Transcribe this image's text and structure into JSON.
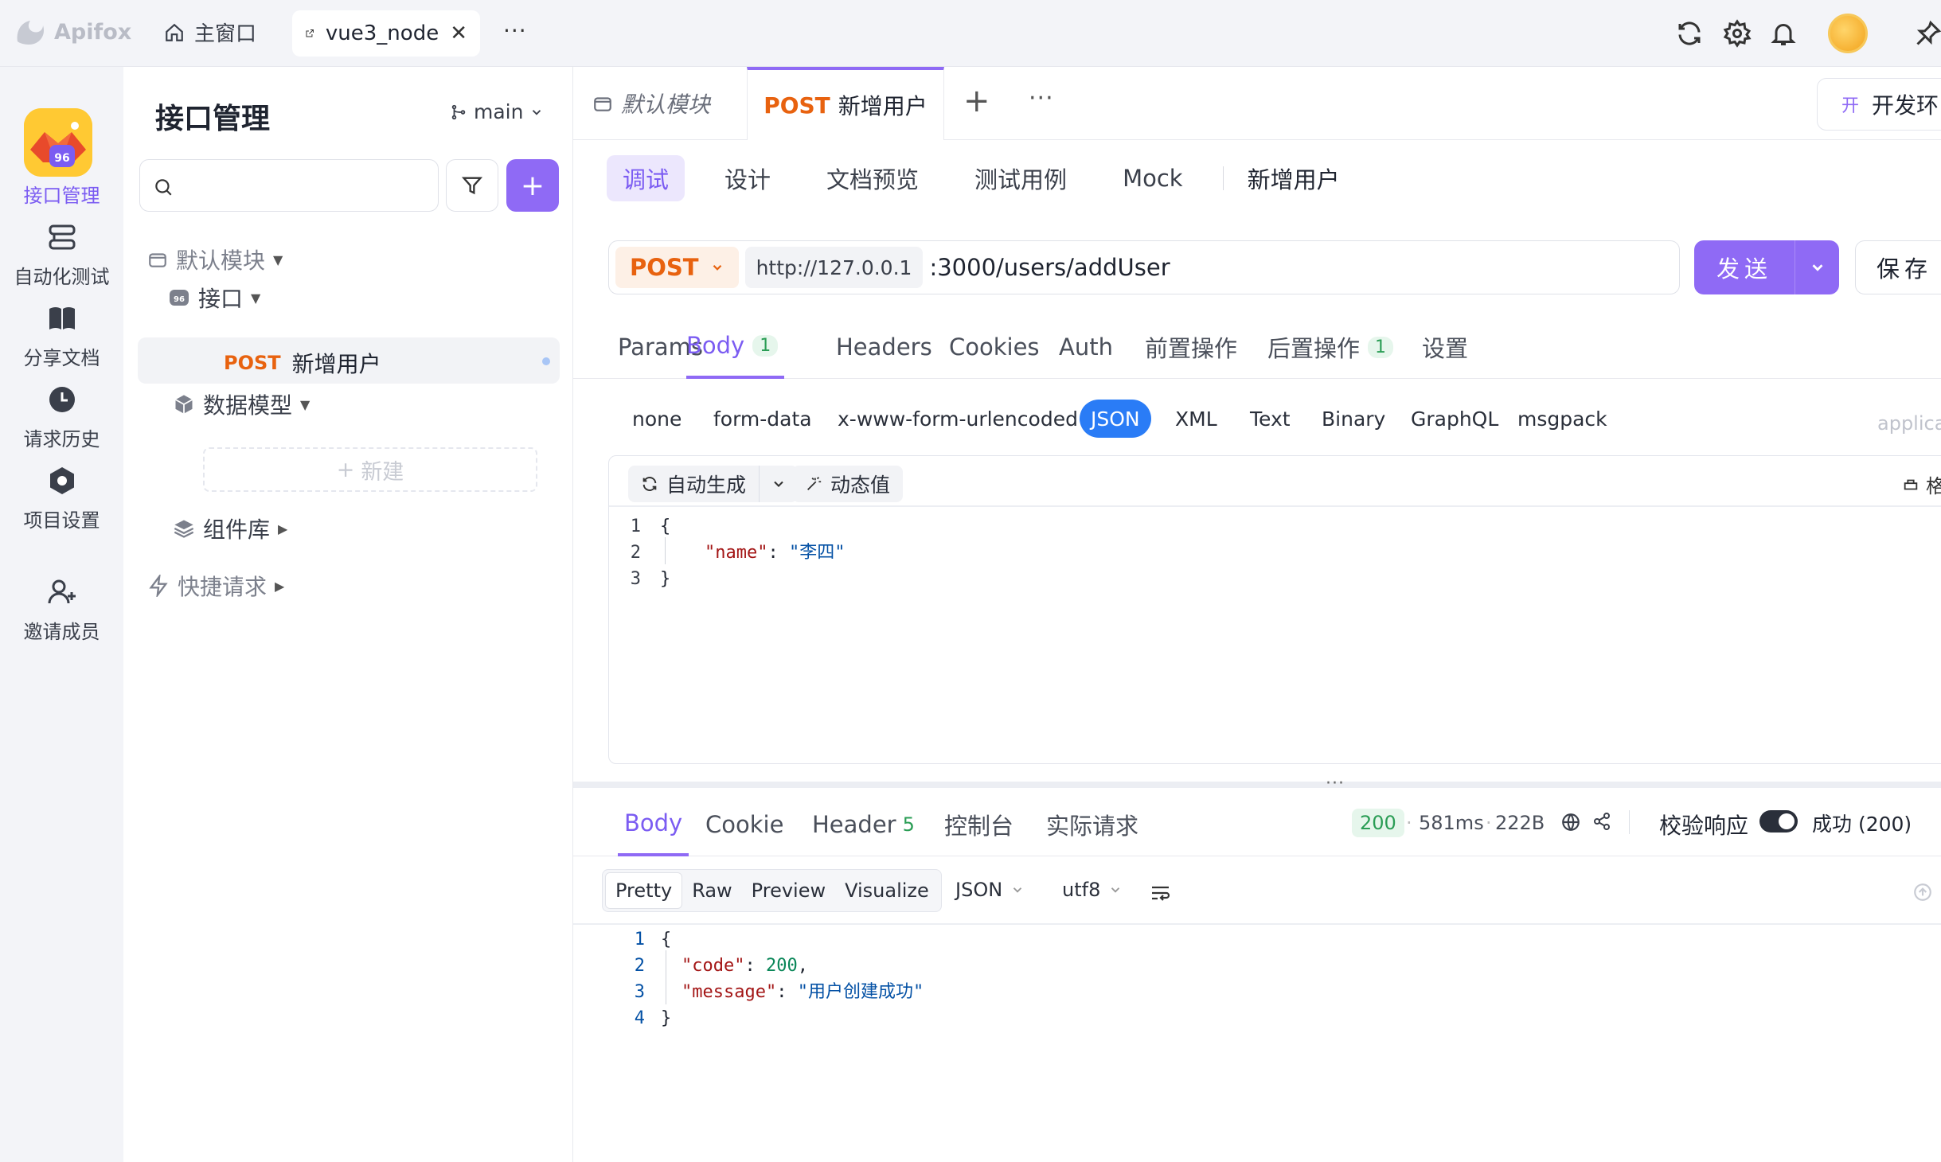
{
  "titlebar": {
    "app_name": "Apifox",
    "home_tab": "主窗口",
    "project_tab": "vue3_node",
    "close_glyph": "✕",
    "more_glyph": "···"
  },
  "rail": {
    "items": [
      {
        "label": "接口管理",
        "icon": "api-icon",
        "active": true
      },
      {
        "label": "自动化测试",
        "icon": "automation-icon"
      },
      {
        "label": "分享文档",
        "icon": "book-icon"
      },
      {
        "label": "请求历史",
        "icon": "clock-icon"
      },
      {
        "label": "项目设置",
        "icon": "settings-hex-icon"
      },
      {
        "label": "邀请成员",
        "icon": "user-add-icon"
      }
    ]
  },
  "sidebar": {
    "title": "接口管理",
    "branch": "main",
    "add_glyph": "+",
    "tree": {
      "default_module": "默认模块",
      "interfaces": "接口",
      "selected_method": "POST",
      "selected_name": "新增用户",
      "data_models": "数据模型",
      "new_label": "新建",
      "new_glyph": "+",
      "components": "组件库",
      "quick_requests": "快捷请求"
    }
  },
  "main": {
    "doc_tabs": {
      "module_tab": "默认模块",
      "active_method": "POST",
      "active_name": "新增用户",
      "add_glyph": "+",
      "more_glyph": "···",
      "env_badge": "开",
      "env_name": "开发环"
    },
    "mode_tabs": [
      "调试",
      "设计",
      "文档预览",
      "测试用例",
      "Mock"
    ],
    "api_name": "新增用户",
    "url": {
      "method": "POST",
      "base": "http://127.0.0.1",
      "path": ":3000/users/addUser"
    },
    "send_label": "发送",
    "save_label": "保存",
    "req_tabs": {
      "params": "Params",
      "body": "Body",
      "body_count": "1",
      "headers": "Headers",
      "cookies": "Cookies",
      "auth": "Auth",
      "pre": "前置操作",
      "post": "后置操作",
      "post_count": "1",
      "settings": "设置"
    },
    "body_types": [
      "none",
      "form-data",
      "x-www-form-urlencoded",
      "JSON",
      "XML",
      "Text",
      "Binary",
      "GraphQL",
      "msgpack"
    ],
    "body_type_active": "JSON",
    "content_type_hint": "applica",
    "editor": {
      "autogen_label": "自动生成",
      "dynamic_label": "动态值",
      "format_label": "格",
      "lines": [
        {
          "n": "1",
          "text": "{"
        },
        {
          "n": "2",
          "key": "\"name\"",
          "colon": ": ",
          "value": "\"李四\""
        },
        {
          "n": "3",
          "text": "}"
        }
      ]
    },
    "splitter_glyph": "···",
    "response": {
      "tabs": {
        "body": "Body",
        "cookie": "Cookie",
        "header": "Header",
        "header_count": "5",
        "console": "控制台",
        "actual": "实际请求"
      },
      "status": "200",
      "time": "581ms",
      "size": "222B",
      "dot": "·",
      "verify_label": "校验响应",
      "verify_result": "成功 (200)",
      "view_modes": [
        "Pretty",
        "Raw",
        "Preview",
        "Visualize"
      ],
      "format": "JSON",
      "encoding": "utf8",
      "lines": [
        {
          "n": "1",
          "text": "{"
        },
        {
          "n": "2",
          "key": "\"code\"",
          "colon": ": ",
          "value": "200",
          "trail": ","
        },
        {
          "n": "3",
          "key": "\"message\"",
          "colon": ": ",
          "value": "\"用户创建成功\""
        },
        {
          "n": "4",
          "text": "}"
        }
      ]
    }
  },
  "colors": {
    "accent": "#8f6af5",
    "post": "#e8620f",
    "success": "#2a9d55",
    "json_active": "#2a7cf6"
  }
}
